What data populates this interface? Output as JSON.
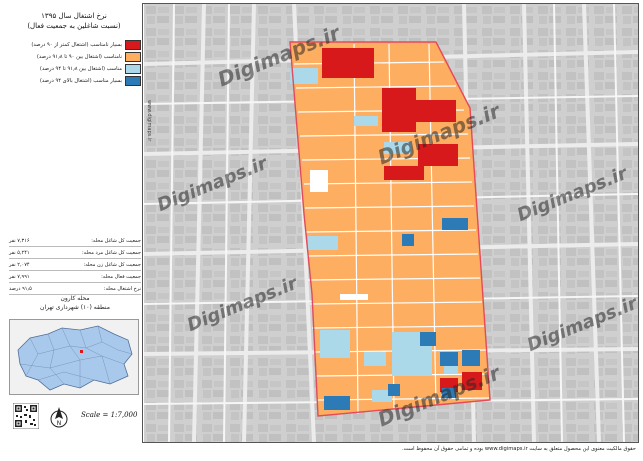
{
  "title": {
    "line1": "نرخ اشتغال سال ۱۳۹۵",
    "line2": "(نسبت شاغلین به جمعیت فعال)"
  },
  "legend": [
    {
      "color": "#d7191c",
      "label": "بسیار نامناسب (اشتغال کمتر از ۹۰ درصد)"
    },
    {
      "color": "#fdae61",
      "label": "نامناسب (اشتغال بین ۹۰ تا ۹۱٫۸ درصد)"
    },
    {
      "color": "#abd9e9",
      "label": "مناسب (اشتغال بین ۹۱٫۸ تا ۹۴ درصد)"
    },
    {
      "color": "#2c7bb6",
      "label": "بسیار مناسب (اشتغال بالای ۹۴ درصد)"
    }
  ],
  "stats": [
    {
      "label": "جمعیت کل شاغل محله:",
      "value": "۷,۳۱۶ نفر"
    },
    {
      "label": "جمعیت کل شاغل مرد محله:",
      "value": "۵,۲۴۱ نفر"
    },
    {
      "label": "جمعیت کل شاغل زن محله:",
      "value": "۲,۰۷۴ نفر"
    },
    {
      "label": "جمعیت فعال محله:",
      "value": "۷,۹۹۱ نفر"
    },
    {
      "label": "نرخ اشتغال محله:",
      "value": "۹۱٫۵ درصد"
    }
  ],
  "location": {
    "neighborhood": "محله کارون",
    "district": "منطقه (۱۰) شهرداری تهران"
  },
  "scale": "Scale = 1:7,000",
  "footer": "حقوق مالکیت معنوی این محصول متعلق به سایت www.digimaps.ir بوده و تمامی حقوق آن محفوظ است.",
  "watermark": "Digimaps.ir",
  "watermark_side": "www.digimaps.ir",
  "colors": {
    "very_poor": "#d7191c",
    "poor": "#fdae61",
    "good": "#abd9e9",
    "very_good": "#2c7bb6",
    "boundary": "#e34a5a"
  }
}
